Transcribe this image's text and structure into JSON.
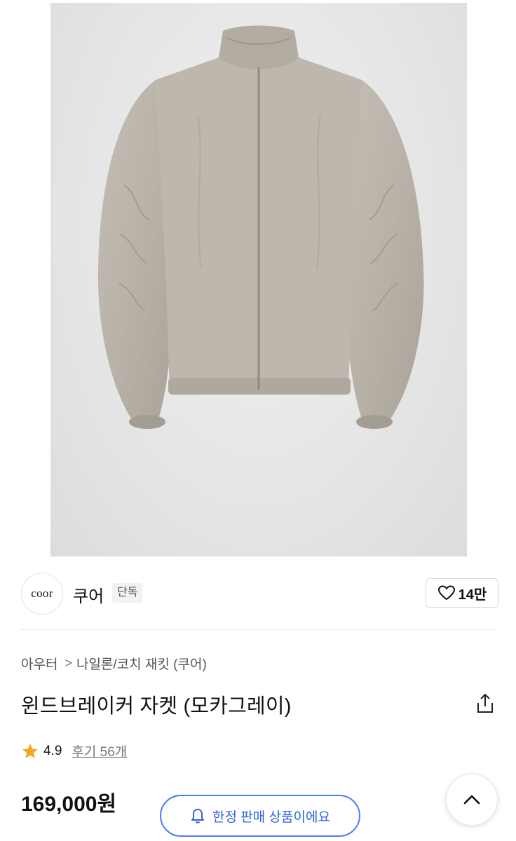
{
  "brand": {
    "logo_text": "coor",
    "name": "쿠어",
    "badge": "단독"
  },
  "like": {
    "icon": "heart-outline-icon",
    "count": "14만"
  },
  "breadcrumb": {
    "category": "아우터",
    "separator": ">",
    "subcategory": "나일론/코치 재킷 (쿠어)"
  },
  "product": {
    "title": "윈드브레이커 자켓 (모카그레이)",
    "share_icon": "share-icon"
  },
  "rating": {
    "icon": "star-icon",
    "star_color": "#f5a623",
    "score": "4.9",
    "reviews": "후기 56개"
  },
  "price": "169,000원",
  "notice": {
    "icon": "bell-icon",
    "label": "한정 판매 상품이에요",
    "accent": "#4b7cf0"
  },
  "scroll_top_icon": "chevron-up-icon"
}
